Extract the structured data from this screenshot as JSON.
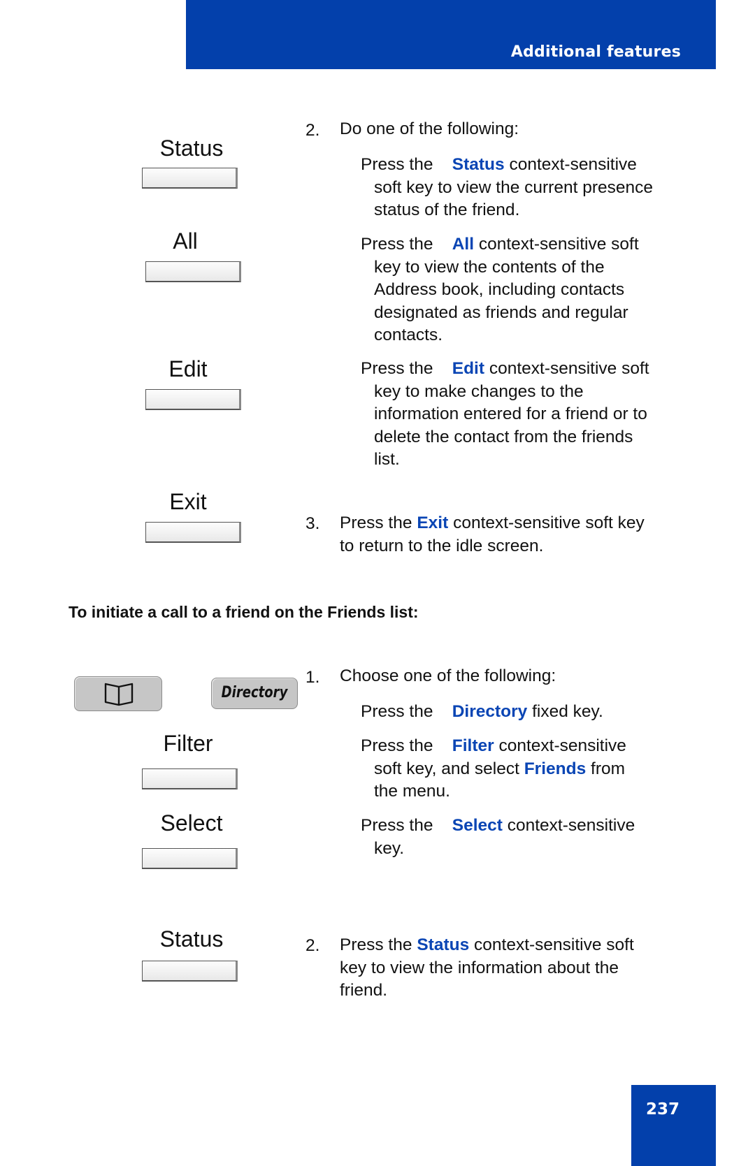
{
  "header": {
    "title": "Additional features"
  },
  "page_number": "237",
  "colors": {
    "brand_blue": "#0340ab",
    "keyword_blue": "#0a45b4"
  },
  "section1": {
    "softkeys": [
      {
        "label": "Status"
      },
      {
        "label": "All"
      },
      {
        "label": "Edit"
      },
      {
        "label": "Exit"
      }
    ],
    "step2": {
      "number": "2.",
      "intro": "Do one of the following:",
      "options": [
        {
          "prefix": "Press the",
          "keyword": "Status",
          "first_rest": "context-sensitive",
          "lines": [
            "soft key to view the current presence",
            "status of the friend."
          ]
        },
        {
          "prefix": "Press the",
          "keyword": "All",
          "first_rest": "context-sensitive soft",
          "lines": [
            "key to view the contents of the",
            "Address book, including contacts",
            "designated as friends and regular",
            "contacts."
          ]
        },
        {
          "prefix": "Press the",
          "keyword": "Edit",
          "first_rest": "context-sensitive soft",
          "lines": [
            "key to make changes to the",
            "information entered for a friend or to",
            "delete the contact from the friends",
            "list."
          ]
        }
      ]
    },
    "step3": {
      "number": "3.",
      "prefix": "Press the",
      "keyword": "Exit",
      "first_rest": "context-sensitive soft key",
      "line2": "to return to the idle screen."
    }
  },
  "section2": {
    "heading": "To initiate a call to a friend on the Friends list:",
    "fixed_keys": [
      {
        "icon": "book-icon"
      },
      {
        "label": "Directory"
      }
    ],
    "softkeys": [
      {
        "label": "Filter"
      },
      {
        "label": "Select"
      },
      {
        "label": "Status"
      }
    ],
    "step1": {
      "number": "1.",
      "intro": "Choose one of the following:",
      "options": [
        {
          "prefix": "Press the",
          "keyword": "Directory",
          "first_rest": "fixed key."
        },
        {
          "prefix": "Press the",
          "keyword": "Filter",
          "first_rest": "context-sensitive",
          "line2_a": "soft key, and select",
          "line2_kw": "Friends",
          "line2_b": "from",
          "line3": "the menu."
        },
        {
          "prefix": "Press the",
          "keyword": "Select",
          "first_rest": "context-sensitive",
          "line2": "key."
        }
      ]
    },
    "step2": {
      "number": "2.",
      "prefix": "Press the",
      "keyword": "Status",
      "first_rest": "context-sensitive soft",
      "line2": "key to view the information about the",
      "line3": "friend."
    }
  }
}
